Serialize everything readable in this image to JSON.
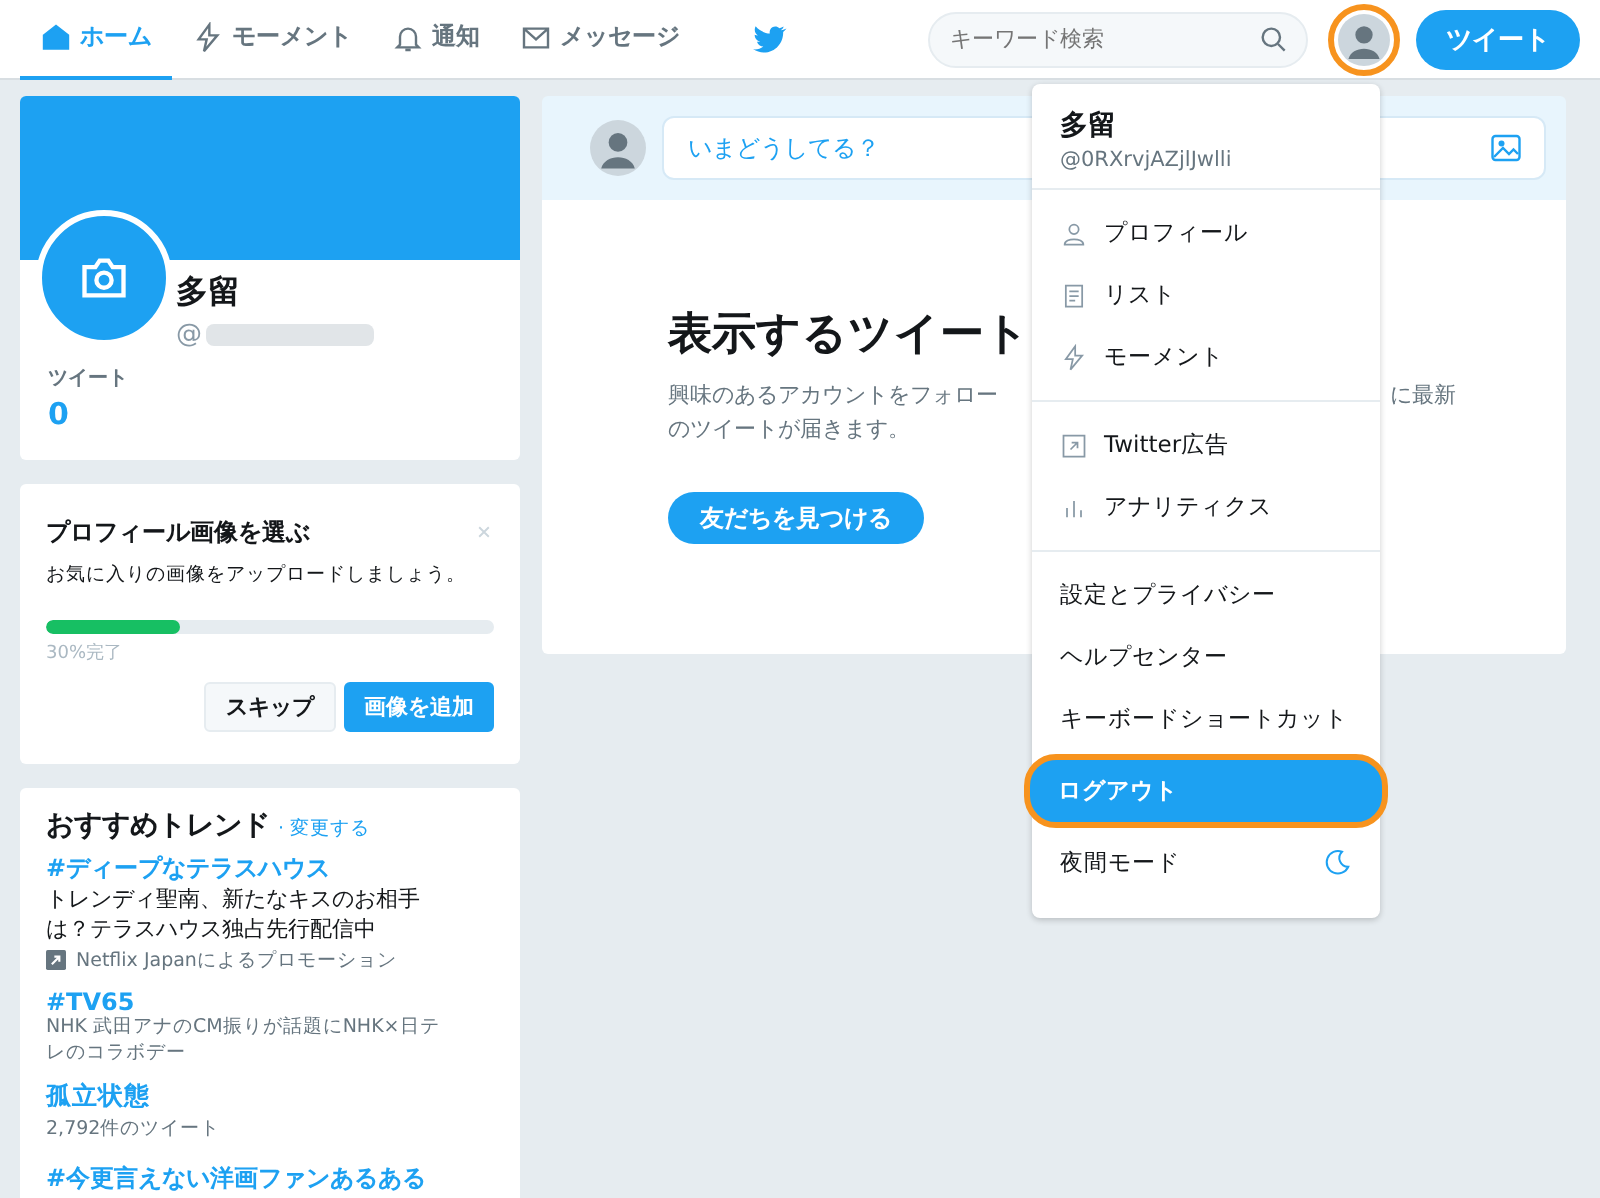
{
  "nav": {
    "tabs": [
      {
        "label": "ホーム",
        "selected": true
      },
      {
        "label": "モーメント",
        "selected": false
      },
      {
        "label": "通知",
        "selected": false
      },
      {
        "label": "メッセージ",
        "selected": false
      }
    ],
    "search": {
      "placeholder": "キーワード検索"
    },
    "avatar": {
      "callout": true
    },
    "tweet_button": "ツイート"
  },
  "profile": {
    "name": "多留",
    "handle": "@",
    "handle_blurred": true,
    "stat_label": "ツイート",
    "stat_value": "0"
  },
  "onboarding": {
    "title": "プロフィール画像を選ぶ",
    "text": "お気に入りの画像をアップロードしましょう。",
    "level": 0.3,
    "progress_text": "30%完了",
    "buttons": [
      {
        "label": "スキップ",
        "kind": "secondary"
      },
      {
        "label": "画像を追加",
        "kind": "primary"
      }
    ]
  },
  "trends": {
    "title": "おすすめトレンド",
    "change_link": "· 変更する",
    "items": [
      {
        "name": "#ディープなテラスハウス",
        "description": "トレンディ聖南、新たなキスのお相手は？テラスハウス独占先行配信中",
        "meta": "Netflix Japanによるプロモーション",
        "kind": "promoted"
      },
      {
        "name": "#TV65",
        "description": "NHK 武田アナのCM振りが話題にNHK×日テレのコラボデー",
        "kind": "small"
      },
      {
        "name": "孤立状態",
        "meta": "2,792件のツイート",
        "kind": "count"
      },
      {
        "name": "#今更言えない洋画ファンあるある",
        "kind": "plain"
      }
    ]
  },
  "composer": {
    "placeholder": "いまどうしてる？"
  },
  "empty_state": {
    "title": "表示するツイート",
    "line_1": "興味のあるアカウントをフォロー",
    "line_1_end": "に最新",
    "line_2": "のツイートが届きます。",
    "button": "友だちを見つける"
  },
  "menu": {
    "name": "多留",
    "handle": "@0RXrvjAZjlJwlli",
    "sections": [
      [
        {
          "label": "プロフィール",
          "selected": false
        },
        {
          "label": "リスト",
          "selected": false
        },
        {
          "label": "モーメント",
          "selected": false
        }
      ],
      [
        {
          "label": "Twitter広告",
          "selected": false
        },
        {
          "label": "アナリティクス",
          "selected": false
        }
      ],
      [
        {
          "label": "設定とプライバシー",
          "selected": false
        },
        {
          "label": "ヘルプセンター",
          "selected": false
        },
        {
          "label": "キーボードショートカット",
          "selected": false
        },
        {
          "label": "ログアウト",
          "selected": true,
          "callout": true
        },
        {
          "label": "夜間モード",
          "kind": "toggle",
          "selected": false
        }
      ]
    ]
  }
}
